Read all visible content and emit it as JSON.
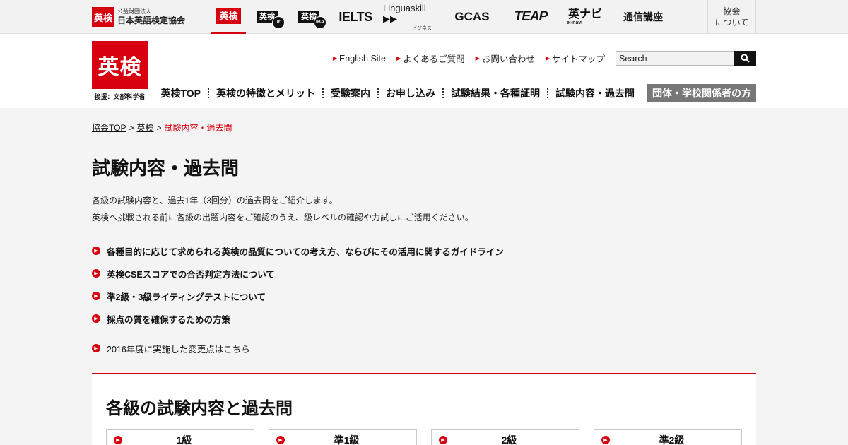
{
  "topbar": {
    "association_badge": "英検",
    "association_small": "公益財団法人",
    "association_name": "日本英語検定協会",
    "brands": [
      {
        "label": "英検",
        "active": true
      },
      {
        "label": "英検",
        "tag": "Jr."
      },
      {
        "label": "英検",
        "tag": "IBA"
      },
      {
        "label": "IELTS"
      },
      {
        "label": "Linguaskill",
        "sub": "ビジネス"
      },
      {
        "label": "CAS"
      },
      {
        "label": "TEAP"
      },
      {
        "label": "英ナビ",
        "sub": "ei-navi"
      },
      {
        "label": "通信講座"
      }
    ],
    "about": [
      "協会",
      "について"
    ]
  },
  "header": {
    "logo_text": "英検",
    "logo_sub": "後援：文部科学省",
    "utility_links": [
      "English Site",
      "よくあるご質問",
      "お問い合わせ",
      "サイトマップ"
    ],
    "search_value": "Search",
    "nav": [
      "英検TOP",
      "英検の特徴とメリット",
      "受験案内",
      "お申し込み",
      "試験結果・各種証明",
      "試験内容・過去問"
    ],
    "nav_highlight": "団体・学校関係者の方"
  },
  "breadcrumb": {
    "items": [
      "協会TOP",
      "英検"
    ],
    "current": "試験内容・過去問"
  },
  "page": {
    "title": "試験内容・過去問",
    "intro_1": "各級の試験内容と、過去1年（3回分）の過去問をご紹介します。",
    "intro_2": "英検へ挑戦される前に各級の出題内容をご確認のうえ、級レベルの確認や力試しにご活用ください。",
    "links": [
      "各種目的に応じて求められる英検の品質についての考え方、ならびにその活用に関するガイドライン",
      "英検CSEスコアでの合否判定方法について",
      "準2級・3級ライティングテストについて",
      "採点の質を確保するための方策"
    ],
    "extra_link": "2016年度に実施した変更点はこちら"
  },
  "section": {
    "title": "各級の試験内容と過去問",
    "grades": [
      "1級",
      "準1級",
      "2級",
      "準2級"
    ]
  },
  "colors": {
    "accent": "#d7000f"
  }
}
